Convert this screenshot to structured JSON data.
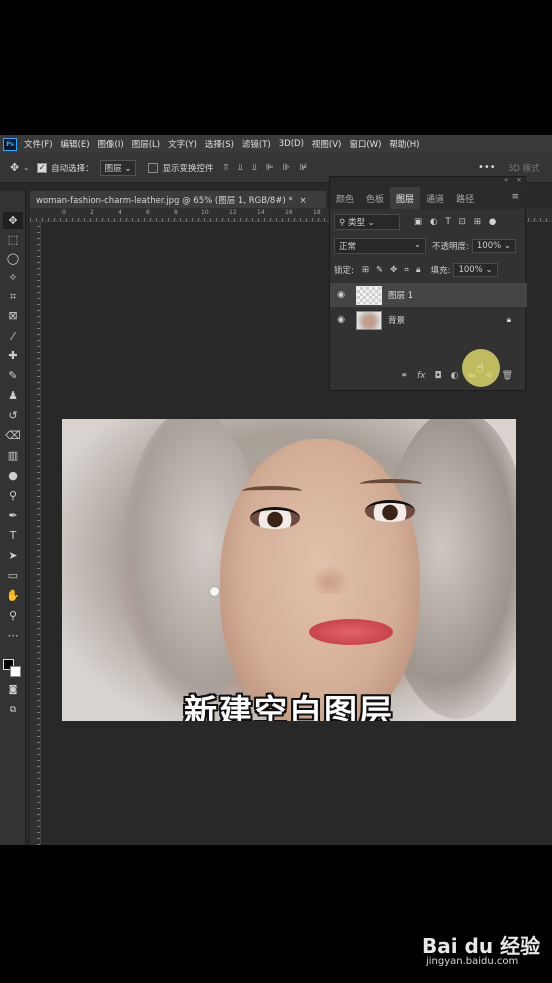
{
  "menubar": {
    "logo": "Ps",
    "items": [
      "文件(F)",
      "编辑(E)",
      "图像(I)",
      "图层(L)",
      "文字(Y)",
      "选择(S)",
      "滤镜(T)",
      "3D(D)",
      "视图(V)",
      "窗口(W)",
      "帮助(H)"
    ]
  },
  "options": {
    "auto_select_label": "自动选择：",
    "auto_select_value": "图层",
    "show_transform_label": "显示变换控件",
    "mode_3d": "3D 模式"
  },
  "document": {
    "tab_title": "woman-fashion-charm-leather.jpg @ 65% (图层 1, RGB/8#) *",
    "close": "×",
    "ruler_ticks": [
      "0",
      "2",
      "4",
      "6",
      "8",
      "10",
      "12",
      "14",
      "16",
      "18"
    ],
    "caption": "新建空白图层"
  },
  "layers_panel": {
    "tabs": [
      "颜色",
      "色板",
      "图层",
      "通道",
      "路径"
    ],
    "active_tab": "图层",
    "filter_kind": "类型",
    "blend_mode": "正常",
    "opacity_label": "不透明度:",
    "opacity_value": "100%",
    "lock_label": "锁定:",
    "fill_label": "填充:",
    "fill_value": "100%",
    "layers": [
      {
        "name": "图层 1",
        "selected": true,
        "visible": true
      },
      {
        "name": "背景",
        "selected": false,
        "visible": true,
        "locked": true
      }
    ],
    "footer_fx": "fx"
  },
  "watermark": {
    "brand": "Bai du 经验",
    "url": "jingyan.baidu.com"
  },
  "colors": {
    "app_bg": "#282828",
    "panel_bg": "#323232",
    "accent": "#31a8ff",
    "cursor_highlight": "#dad469"
  }
}
